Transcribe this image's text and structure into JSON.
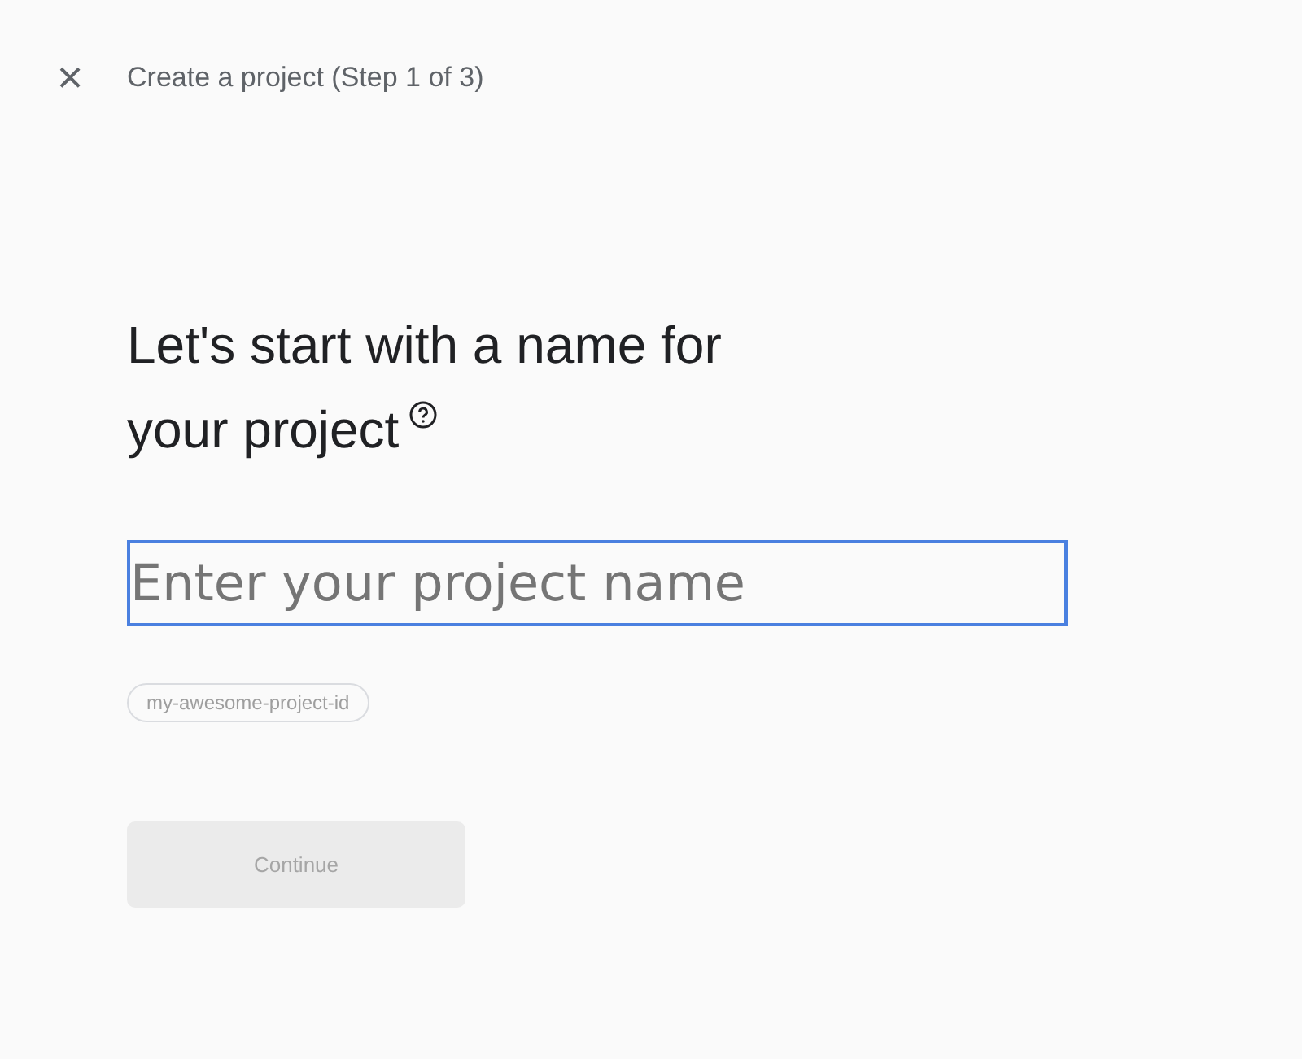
{
  "header": {
    "close_label": "×",
    "title": "Create a project (Step 1 of 3)"
  },
  "heading": {
    "lines": [
      "Let's start with a name for",
      "your project"
    ]
  },
  "project_name_field": {
    "placeholder": "Enter your project name",
    "focused": true
  },
  "project_id_chip": {
    "text": "my-awesome-project-id"
  },
  "continue_button": {
    "label": "Continue",
    "disabled": true
  }
}
